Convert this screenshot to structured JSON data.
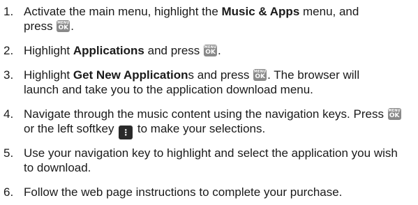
{
  "icons": {
    "menu_ok_key": {
      "line1": "MENU",
      "line2": "OK"
    },
    "left_softkey": {
      "glyph": "⋮"
    }
  },
  "steps": [
    {
      "number": "1.",
      "t1": "Activate the main menu, highlight the ",
      "b1": "Music & Apps",
      "t2": " menu, and",
      "t3": "press ",
      "t4": "."
    },
    {
      "number": "2.",
      "t1": "Highlight ",
      "b1": "Applications",
      "t2": " and press ",
      "t3": "."
    },
    {
      "number": "3.",
      "t1": "Highlight ",
      "b1": "Get New Application",
      "t2": "s and press ",
      "t3": ". The browser will",
      "t4": "launch and take you to the application download menu."
    },
    {
      "number": "4.",
      "t1": "Navigate through the music content using the navigation keys. Press ",
      "t2": "or the left softkey ",
      "t3": " to make your selections."
    },
    {
      "number": "5.",
      "t1": "Use your navigation key to highlight and select the application you wish",
      "t2": "to download."
    },
    {
      "number": "6.",
      "t1": "Follow the web page instructions to complete your purchase."
    }
  ]
}
